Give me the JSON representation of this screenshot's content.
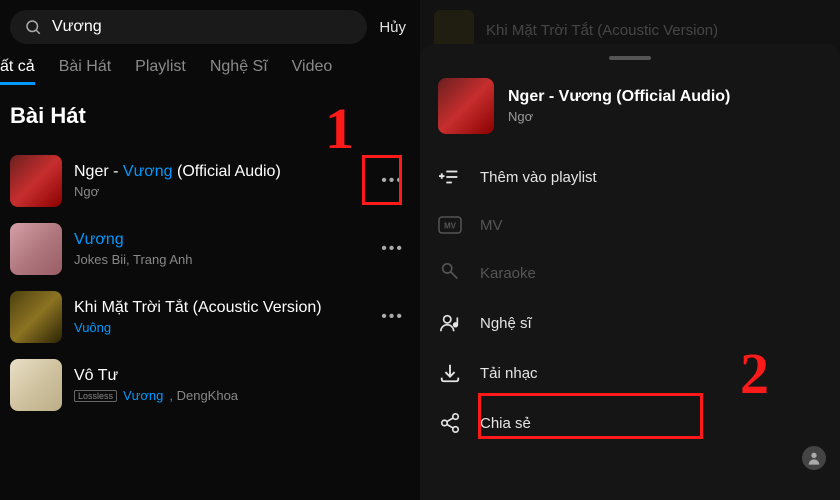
{
  "left": {
    "search": {
      "value": "Vương",
      "cancel": "Hủy"
    },
    "tabs": [
      "ất cả",
      "Bài Hát",
      "Playlist",
      "Nghệ Sĩ",
      "Video"
    ],
    "active_tab_index": 0,
    "section_title": "Bài Hát",
    "songs": [
      {
        "title_pre": "Nger - ",
        "title_hl": "Vương",
        "title_post": " (Official Audio)",
        "artist": "Ngơ",
        "lossless": false
      },
      {
        "title_pre": "",
        "title_hl": "Vương",
        "title_post": "",
        "artist": "Jokes Bii, Trang Anh",
        "lossless": false
      },
      {
        "title_pre": "Khi Mặt Trời Tắt (Acoustic Version)",
        "title_hl": "",
        "title_post": "",
        "artist": "Vuông",
        "artist_hl": true,
        "lossless": false
      },
      {
        "title_pre": "Vô Tư",
        "title_hl": "",
        "title_post": "",
        "artist_pre": "",
        "artist_hl_text": "Vương",
        "artist_post": ", DengKhoa",
        "lossless": true
      }
    ]
  },
  "right": {
    "bg_song_title": "Khi Mặt Trời Tắt (Acoustic Version)",
    "header": {
      "title": "Nger - Vương (Official Audio)",
      "artist": "Ngơ"
    },
    "menu": [
      {
        "icon": "playlist-add",
        "label": "Thêm vào playlist",
        "disabled": false
      },
      {
        "icon": "mv",
        "label": "MV",
        "disabled": true
      },
      {
        "icon": "karaoke",
        "label": "Karaoke",
        "disabled": true
      },
      {
        "icon": "artist",
        "label": "Nghệ sĩ",
        "disabled": false
      },
      {
        "icon": "download",
        "label": "Tải nhạc",
        "disabled": false
      },
      {
        "icon": "share",
        "label": "Chia sẻ",
        "disabled": false
      }
    ]
  },
  "annotations": {
    "n1": "1",
    "n2": "2"
  }
}
